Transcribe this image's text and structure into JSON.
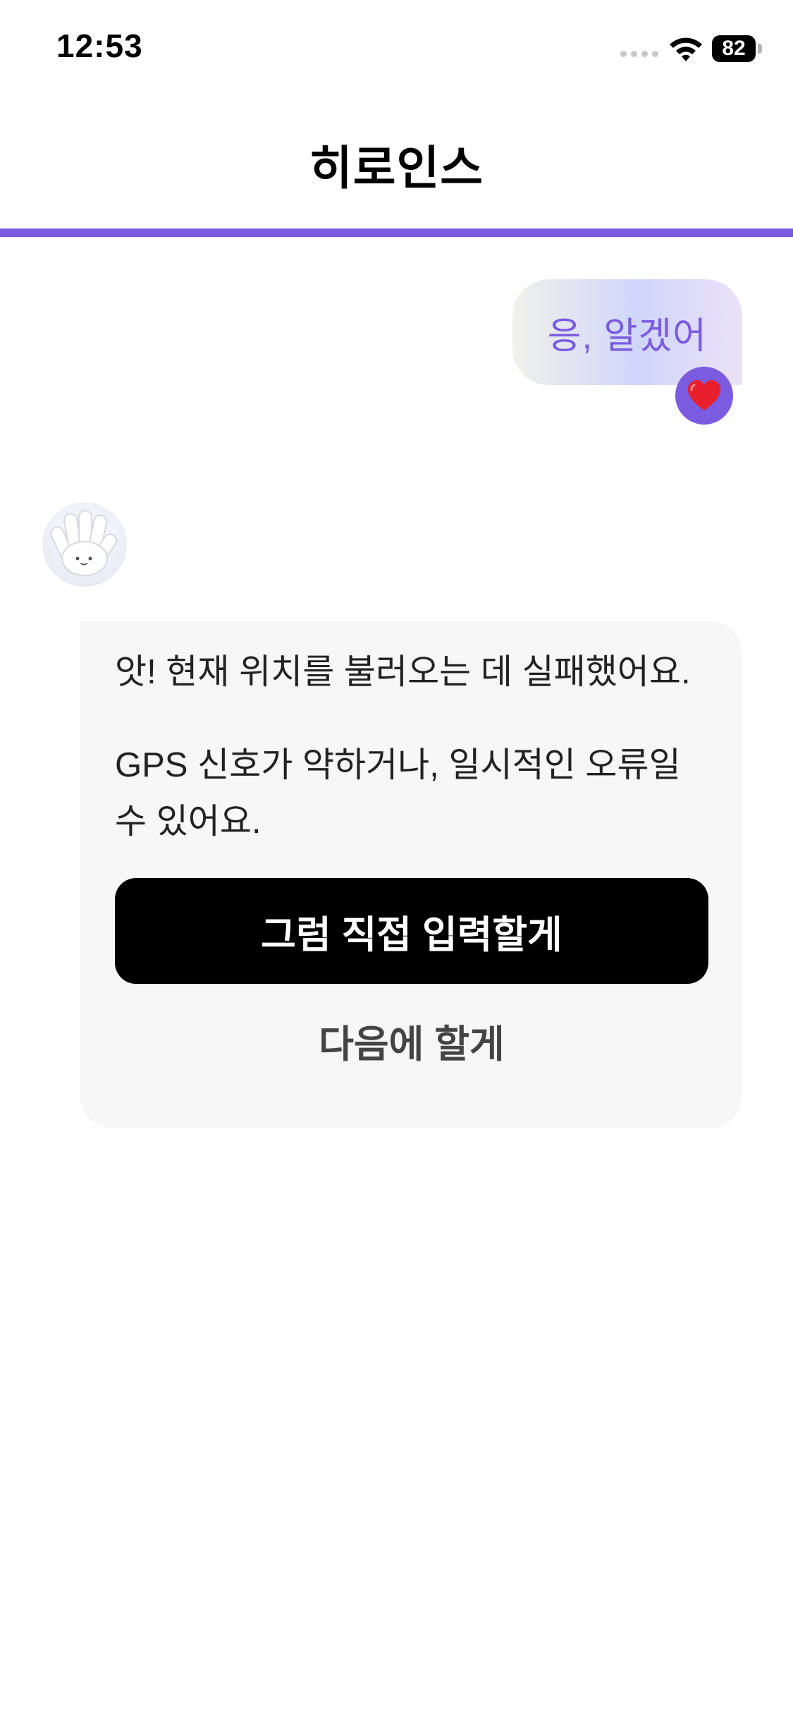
{
  "status_bar": {
    "time": "12:53",
    "battery_percent": "82",
    "icons": [
      "cellular-signal-icon",
      "wifi-icon",
      "battery-icon"
    ]
  },
  "header": {
    "title": "히로인스",
    "progress": 1.0,
    "accent_color": "#7b5be0"
  },
  "chat": {
    "user_message": {
      "text": "응, 알겠어",
      "reaction": "heart-icon"
    },
    "bot_message": {
      "avatar": "glove-mascot-avatar",
      "paragraphs": [
        "앗! 현재 위치를 불러오는 데 실패했어요.",
        "GPS 신호가 약하거나, 일시적인 오류일 수 있어요."
      ],
      "primary_action": "그럼 직접 입력할게",
      "secondary_action": "다음에 할게"
    }
  }
}
